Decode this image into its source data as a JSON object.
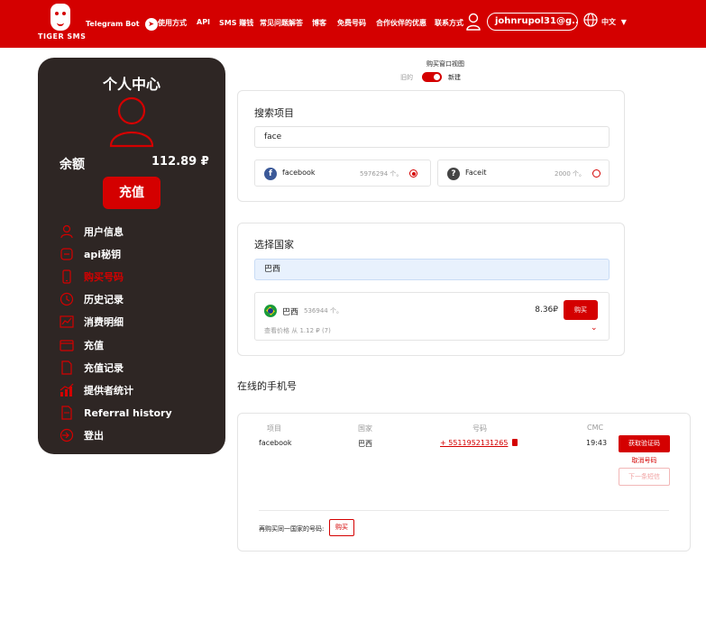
{
  "header": {
    "logo_text": "TIGER SMS",
    "telegram_label": "Telegram Bot",
    "nav": [
      "使用方式",
      "API",
      "SMS 赚钱",
      "常见问题解答",
      "博客",
      "免费号码",
      "合作伙伴的优惠",
      "联系方式"
    ],
    "email": "johnrupol31@g...",
    "language": "中文"
  },
  "sidebar": {
    "title": "个人中心",
    "balance_label": "余额",
    "balance_value": "112.89 ₽",
    "topup_label": "充值",
    "menu": [
      {
        "label": "用户信息",
        "icon": "user-icon",
        "active": false
      },
      {
        "label": "api秘钥",
        "icon": "api-key-icon",
        "active": false
      },
      {
        "label": "购买号码",
        "icon": "phone-icon",
        "active": true
      },
      {
        "label": "历史记录",
        "icon": "history-icon",
        "active": false
      },
      {
        "label": "消费明细",
        "icon": "chart-icon",
        "active": false
      },
      {
        "label": "充值",
        "icon": "wallet-icon",
        "active": false
      },
      {
        "label": "充值记录",
        "icon": "document-icon",
        "active": false
      },
      {
        "label": "提供者统计",
        "icon": "stats-icon",
        "active": false
      },
      {
        "label": "Referral history",
        "icon": "referral-icon",
        "active": false
      },
      {
        "label": "登出",
        "icon": "logout-icon",
        "active": false
      }
    ]
  },
  "view_switch": {
    "title": "购买窗口视图",
    "old_label": "旧的",
    "new_label": "新建"
  },
  "search_card": {
    "title": "搜索项目",
    "query": "face",
    "results": [
      {
        "name": "facebook",
        "count": "5976294 个。",
        "selected": true,
        "icon": "facebook-icon",
        "color": "#3b5998",
        "glyph": "f"
      },
      {
        "name": "Faceit",
        "count": "2000 个。",
        "selected": false,
        "icon": "faceit-icon",
        "color": "#444444",
        "glyph": "?"
      }
    ]
  },
  "country_card": {
    "title": "选择国家",
    "query": "巴西",
    "country_name": "巴西",
    "country_count": "536944 个。",
    "price": "8.36₽",
    "buy_label": "购买",
    "price_note": "查看价格 从 1.12 ₽ (7)"
  },
  "online": {
    "title": "在线的手机号",
    "headers": [
      "项目",
      "国家",
      "号码",
      "СМС"
    ],
    "row": {
      "service": "facebook",
      "country": "巴西",
      "number": "+ 5511952131265",
      "time": "19:43"
    },
    "get_code_label": "获取验证码",
    "cancel_label": "取消号码",
    "next_sms_label": "下一条短信",
    "buy_again_label": "再购买同一国家的号码:",
    "buy_again_button": "购买"
  },
  "colors": {
    "brand_red": "#d40000",
    "sidebar_bg": "#2e2624"
  }
}
